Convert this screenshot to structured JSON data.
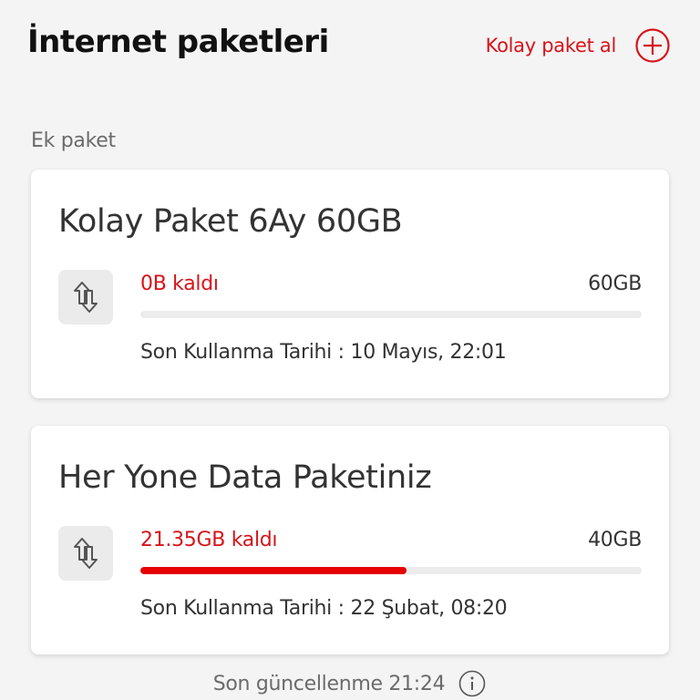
{
  "header": {
    "title": "İnternet paketleri",
    "action_label": "Kolay paket al",
    "action_icon": "plus-circle-icon"
  },
  "section": {
    "label": "Ek paket"
  },
  "packages": [
    {
      "name": "Kolay Paket 6Ay 60GB",
      "icon": "data-transfer-icon",
      "remaining": "0B kaldı",
      "total": "60GB",
      "used_fraction_remaining": 0.0,
      "expiry_label": "Son Kullanma Tarihi :",
      "expiry_value": "10 Mayıs, 22:01"
    },
    {
      "name": "Her Yone Data Paketiniz",
      "icon": "data-transfer-icon",
      "remaining": "21.35GB kaldı",
      "total": "40GB",
      "used_fraction_remaining": 0.53,
      "expiry_label": "Son Kullanma Tarihi :",
      "expiry_value": "22 Şubat, 08:20"
    }
  ],
  "footer": {
    "text": "Son güncellenme 21:24",
    "icon": "info-icon"
  },
  "colors": {
    "accent": "#e60000",
    "accent_text": "#d7141a",
    "background": "#f4f4f4"
  }
}
